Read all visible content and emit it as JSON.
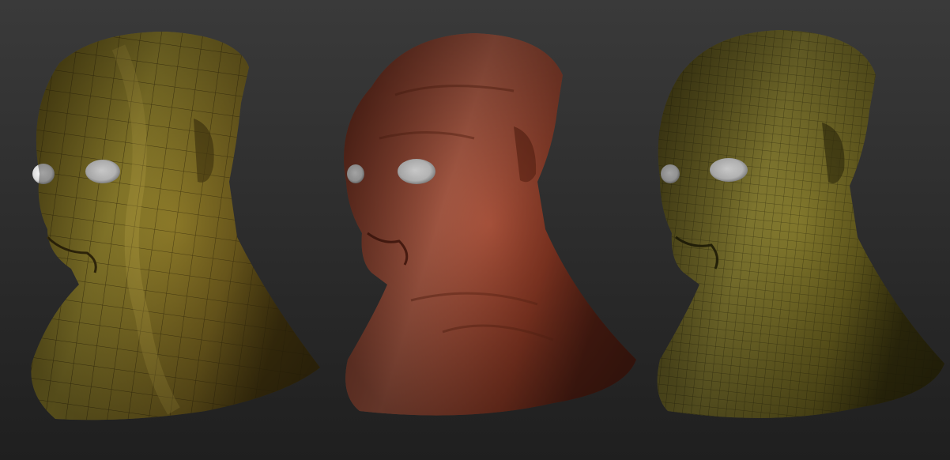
{
  "scene": {
    "background_top": "#3a3a3a",
    "background_bottom": "#202020",
    "models": [
      {
        "name": "low-poly-wireframe-head",
        "skin": "#7d6a1e",
        "skin_light": "#b29a35",
        "wire": "#4a3a10"
      },
      {
        "name": "sculpted-red-clay-head",
        "skin": "#8e3a25",
        "skin_light": "#c06a50",
        "wire": ""
      },
      {
        "name": "subdivided-wireframe-head",
        "skin": "#6e6420",
        "skin_light": "#a69844",
        "wire": "#3a3410"
      }
    ],
    "eye_color": "#e8e8e8"
  }
}
